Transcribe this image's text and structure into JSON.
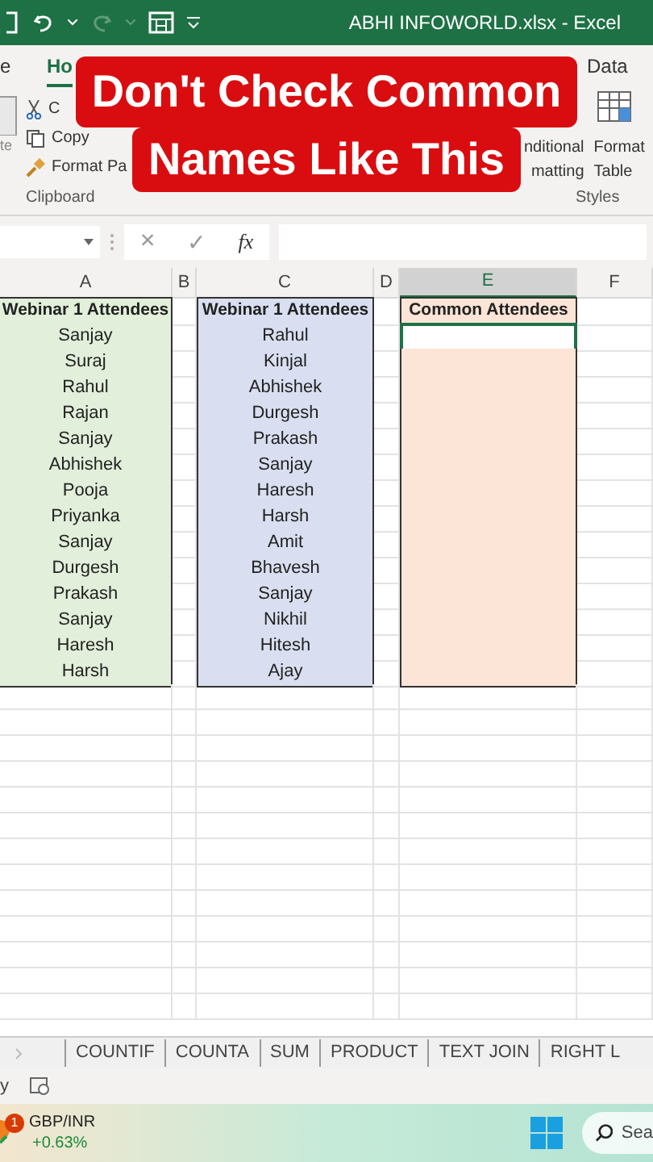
{
  "title_bar": {
    "title": "ABHI INFOWORLD.xlsx  -  Excel",
    "redo_disabled": true
  },
  "ribbon": {
    "tabs": [
      {
        "label": "e",
        "selected": false
      },
      {
        "label": "Ho",
        "selected": true
      },
      {
        "label": "Data",
        "selected": false
      }
    ],
    "clipboard": {
      "paste": "te",
      "cut": "C",
      "copy": "Copy",
      "format_painter": "Format Pa",
      "group": "Clipboard"
    },
    "styles": {
      "conditional_line1": "nditional",
      "conditional_line2": "matting",
      "format_table_line1": "Format",
      "format_table_line2": "Table",
      "group": "Styles"
    }
  },
  "banner": {
    "line1": "Don't Check Common",
    "line2": "Names Like This"
  },
  "formula_bar": {
    "cancel": "×",
    "enter": "✓",
    "function": "fx"
  },
  "sheet": {
    "columns": [
      {
        "label": "A",
        "selected": false
      },
      {
        "label": "B",
        "selected": false
      },
      {
        "label": "C",
        "selected": false
      },
      {
        "label": "D",
        "selected": false
      },
      {
        "label": "E",
        "selected": true
      },
      {
        "label": "F",
        "selected": false
      }
    ],
    "table_a": {
      "header": "Webinar 1 Attendees",
      "values": [
        "Sanjay",
        "Suraj",
        "Rahul",
        "Rajan",
        "Sanjay",
        "Abhishek",
        "Pooja",
        "Priyanka",
        "Sanjay",
        "Durgesh",
        "Prakash",
        "Sanjay",
        "Haresh",
        "Harsh"
      ]
    },
    "table_c": {
      "header": "Webinar 1 Attendees",
      "values": [
        "Rahul",
        "Kinjal",
        "Abhishek",
        "Durgesh",
        "Prakash",
        "Sanjay",
        "Haresh",
        "Harsh",
        "Amit",
        "Bhavesh",
        "Sanjay",
        "Nikhil",
        "Hitesh",
        "Ajay"
      ]
    },
    "table_e": {
      "header": "Common Attendees",
      "cells": [
        {
          "selected": true
        },
        {
          "selected": false
        },
        {
          "selected": false
        },
        {
          "selected": false
        },
        {
          "selected": false
        },
        {
          "selected": false
        },
        {
          "selected": false
        },
        {
          "selected": false
        },
        {
          "selected": false
        },
        {
          "selected": false
        },
        {
          "selected": false
        },
        {
          "selected": false
        },
        {
          "selected": false
        },
        {
          "selected": false
        }
      ]
    }
  },
  "sheet_tabs": [
    {
      "label": "COUNTIF",
      "selected": false
    },
    {
      "label": "COUNTA",
      "selected": false
    },
    {
      "label": "SUM",
      "selected": false
    },
    {
      "label": "PRODUCT",
      "selected": false
    },
    {
      "label": "TEXT JOIN",
      "selected": false
    },
    {
      "label": "RIGHT L",
      "selected": false
    }
  ],
  "status_bar": {
    "text": "y"
  },
  "taskbar": {
    "badge": "1",
    "ticker": "GBP/INR",
    "change": "+0.63%",
    "search": "Sea"
  }
}
